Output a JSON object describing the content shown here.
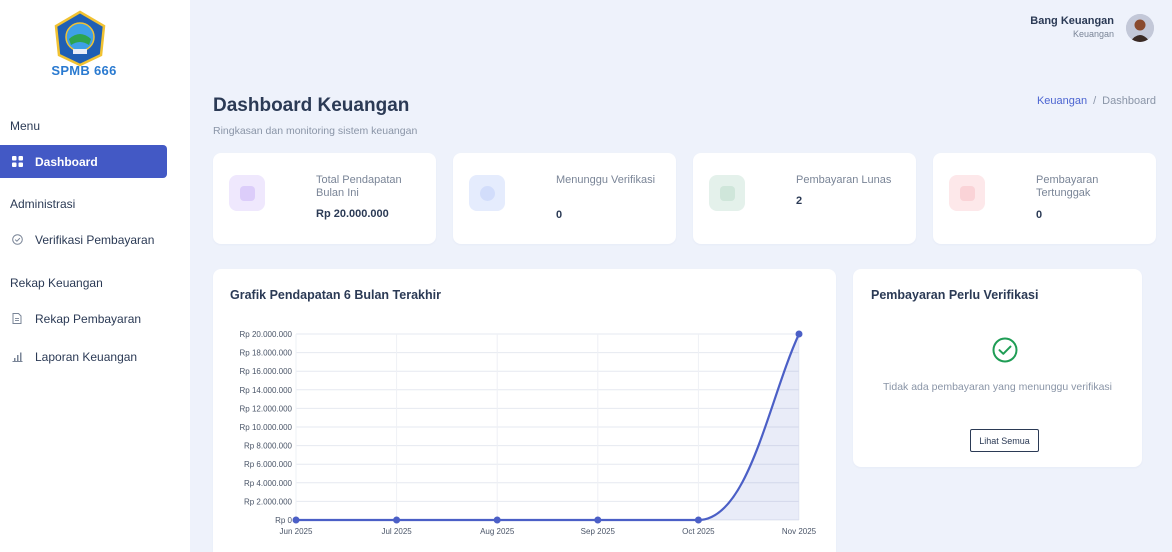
{
  "brand": {
    "name": "SPMB 666"
  },
  "user": {
    "name": "Bang Keuangan",
    "role": "Keuangan"
  },
  "sidebar": {
    "section_menu": "Menu",
    "dashboard": "Dashboard",
    "section_admin": "Administrasi",
    "verifikasi": "Verifikasi Pembayaran",
    "section_rekap": "Rekap Keuangan",
    "rekap": "Rekap Pembayaran",
    "laporan": "Laporan Keuangan"
  },
  "page": {
    "title": "Dashboard Keuangan",
    "subtitle": "Ringkasan dan monitoring sistem keuangan",
    "breadcrumb": [
      "Keuangan",
      "/",
      "Dashboard"
    ]
  },
  "stats": [
    {
      "label": "Total Pendapatan Bulan Ini",
      "value": "Rp 20.000.000",
      "color": "#efe8fd"
    },
    {
      "label": "Menunggu Verifikasi",
      "value": "0",
      "color": "#e5ecfd"
    },
    {
      "label": "Pembayaran Lunas",
      "value": "2",
      "color": "#e4f1eb"
    },
    {
      "label": "Pembayaran Tertunggak",
      "value": "0",
      "color": "#fde8ea"
    }
  ],
  "chart": {
    "title": "Grafik Pendapatan 6 Bulan Terakhir"
  },
  "chart_data": {
    "type": "line",
    "title": "Grafik Pendapatan 6 Bulan Terakhir",
    "categories": [
      "Jun 2025",
      "Jul 2025",
      "Aug 2025",
      "Sep 2025",
      "Oct 2025",
      "Nov 2025"
    ],
    "values": [
      0,
      0,
      0,
      0,
      0,
      20000000
    ],
    "ylim": [
      0,
      20000000
    ],
    "yticks": [
      "Rp 0",
      "Rp 2.000.000",
      "Rp 4.000.000",
      "Rp 6.000.000",
      "Rp 8.000.000",
      "Rp 10.000.000",
      "Rp 12.000.000",
      "Rp 14.000.000",
      "Rp 16.000.000",
      "Rp 18.000.000",
      "Rp 20.000.000"
    ],
    "grid": true,
    "color": "#4b5fc6"
  },
  "verification": {
    "title": "Pembayaran Perlu Verifikasi",
    "empty_text": "Tidak ada pembayaran yang menunggu verifikasi",
    "button": "Lihat Semua"
  }
}
